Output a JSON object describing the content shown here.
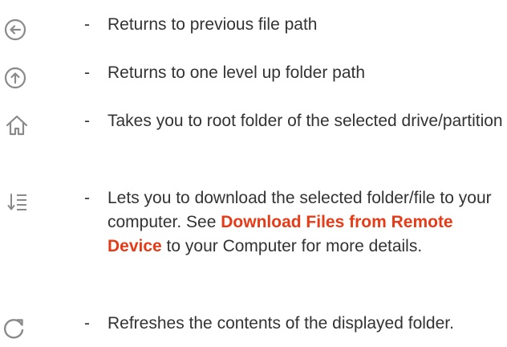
{
  "items": [
    {
      "icon": "back-arrow-icon",
      "dash": "-",
      "text": "Returns to previous file path"
    },
    {
      "icon": "up-arrow-icon",
      "dash": "-",
      "text": "Returns to one level up folder path"
    },
    {
      "icon": "home-icon",
      "dash": "-",
      "text": "Takes you to root folder of the selected drive/partition"
    },
    {
      "icon": "download-list-icon",
      "dash": "-",
      "text_before": "Lets you to download the selected folder/file to your computer. See ",
      "link_text": "Download Files from Remote Device",
      "text_after": " to your Computer for more details."
    },
    {
      "icon": "refresh-icon",
      "dash": "-",
      "text": "Refreshes the contents of the displayed folder."
    }
  ],
  "colors": {
    "text": "#333333",
    "icon": "#8a8a8a",
    "link": "#e63b16"
  }
}
